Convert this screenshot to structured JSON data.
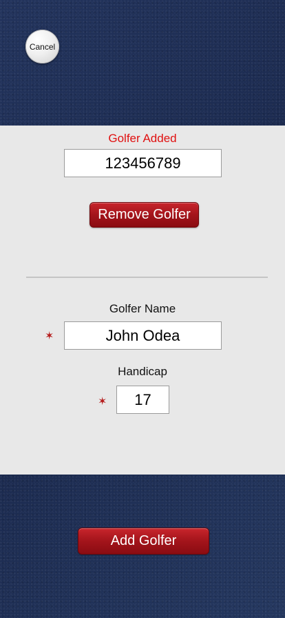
{
  "header": {
    "cancel_label": "Cancel"
  },
  "form": {
    "status_text": "Golfer Added",
    "golfer_id_value": "123456789",
    "remove_button_label": "Remove Golfer",
    "name_label": "Golfer Name",
    "name_value": "John Odea",
    "handicap_label": "Handicap",
    "handicap_value": "17",
    "required_marker": "✶"
  },
  "footer": {
    "add_button_label": "Add Golfer"
  },
  "colors": {
    "status_red": "#e01010",
    "button_red": "#a3141b",
    "panel_gray": "#e8e8e8",
    "background_navy": "#1f2f55"
  }
}
